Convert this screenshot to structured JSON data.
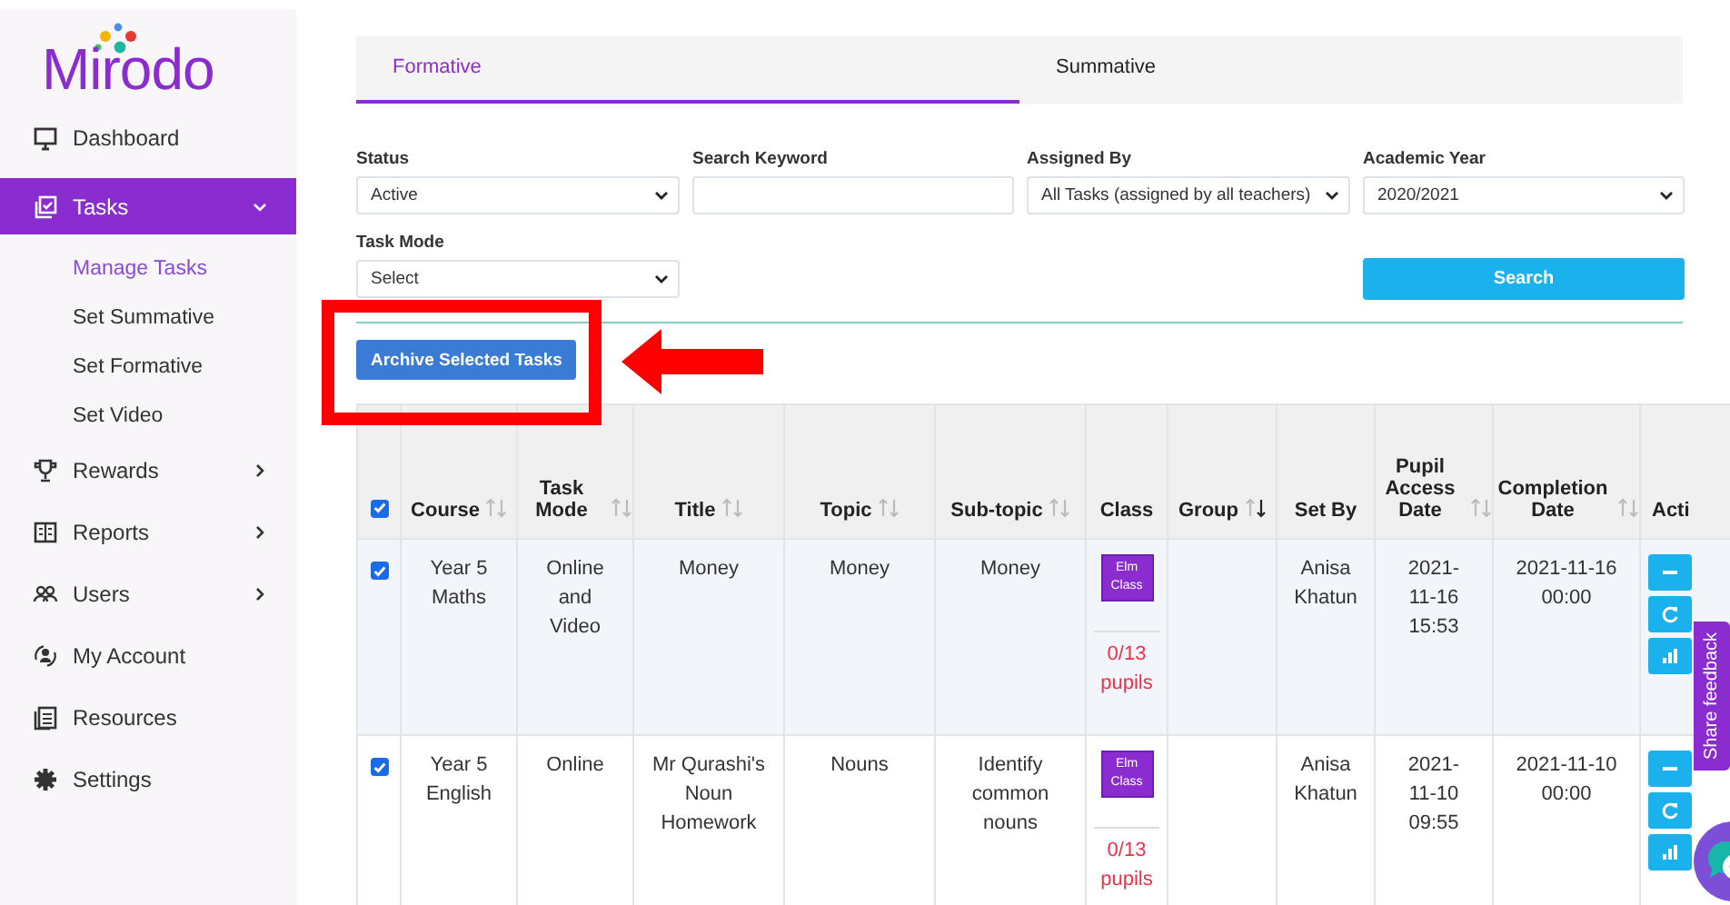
{
  "logo": {
    "text": "Mirodo"
  },
  "sidebar": {
    "items": [
      {
        "label": "Dashboard",
        "selected": false
      },
      {
        "label": "Tasks",
        "selected": true,
        "expanded": true,
        "children": [
          {
            "label": "Manage Tasks",
            "selected": true
          },
          {
            "label": "Set Summative",
            "selected": false
          },
          {
            "label": "Set Formative",
            "selected": false
          },
          {
            "label": "Set Video",
            "selected": false
          }
        ]
      },
      {
        "label": "Rewards",
        "selected": false,
        "expanded": false
      },
      {
        "label": "Reports",
        "selected": false,
        "expanded": false
      },
      {
        "label": "Users",
        "selected": false,
        "expanded": false
      },
      {
        "label": "My Account",
        "selected": false
      },
      {
        "label": "Resources",
        "selected": false
      },
      {
        "label": "Settings",
        "selected": false
      }
    ]
  },
  "tabs": [
    {
      "label": "Formative",
      "selected": true
    },
    {
      "label": "Summative",
      "selected": false
    }
  ],
  "filters": [
    {
      "label": "Status",
      "kind": "select",
      "value": "Active"
    },
    {
      "label": "Search Keyword",
      "kind": "text"
    },
    {
      "label": "Assigned By",
      "kind": "select",
      "value": "All Tasks (assigned by all teachers)"
    },
    {
      "label": "Academic Year",
      "kind": "select",
      "value": "2020/2021"
    },
    {
      "label": "Task Mode",
      "kind": "select",
      "value": "Select"
    }
  ],
  "search_button": "Search",
  "archive_button": "Archive Selected Tasks",
  "annotation": {
    "highlight_box": true,
    "arrow": true
  },
  "table": {
    "select_all_checked": true,
    "columns": [
      {
        "label": "Course",
        "sorted": false
      },
      {
        "label": "Task Mode",
        "sorted": false
      },
      {
        "label": "Title",
        "sorted": false
      },
      {
        "label": "Topic",
        "sorted": false
      },
      {
        "label": "Sub-topic",
        "sorted": false
      },
      {
        "label": "Class"
      },
      {
        "label": "Group",
        "sorted": true
      },
      {
        "label": "Set By"
      },
      {
        "label": "Pupil Access Date",
        "sorted": false
      },
      {
        "label": "Completion Date",
        "sorted": false
      },
      {
        "label": "Acti"
      }
    ],
    "rows": [
      {
        "checked": true,
        "course": "Year 5 Maths",
        "task_mode": "Online and Video",
        "title": "Money",
        "topic": "Money",
        "subtopic": "Money",
        "class_badge": "Elm Class",
        "pupils": "0/13 pupils",
        "set_by": "Anisa Khatun",
        "access_date": "2021-11-16 15:53",
        "completion_date": "2021-11-16 00:00"
      },
      {
        "checked": true,
        "course": "Year 5 English",
        "task_mode": "Online",
        "title": "Mr Qurashi's Noun Homework",
        "topic": "Nouns",
        "subtopic": "Identify common nouns",
        "class_badge": "Elm Class",
        "pupils": "0/13 pupils",
        "set_by": "Anisa Khatun",
        "access_date": "2021-11-10 09:55",
        "completion_date": "2021-11-10 00:00"
      }
    ]
  },
  "feedback_tab": "Share feedback"
}
